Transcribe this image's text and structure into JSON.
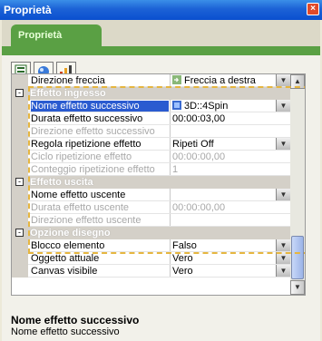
{
  "window": {
    "title": "Proprietà",
    "close_label": "×"
  },
  "tab": {
    "label": "Proprietà"
  },
  "toolbar": {
    "buttons": [
      "categorized-view-icon",
      "object-icon",
      "chart-icon"
    ]
  },
  "rows": [
    {
      "kind": "prop",
      "name": "Direzione freccia",
      "value": "Freccia a destra",
      "value_icon": "arrow-image-icon",
      "dropdown": true
    },
    {
      "kind": "cat",
      "name": "Effetto ingresso",
      "toggle": "-"
    },
    {
      "kind": "prop",
      "name": "Nome effetto successivo",
      "value": "3D::4Spin",
      "value_icon": "effect-icon",
      "dropdown": true,
      "selected": true
    },
    {
      "kind": "prop",
      "name": "Durata effetto successivo",
      "value": "00:00:03,00"
    },
    {
      "kind": "prop",
      "name": "Direzione effetto successivo",
      "value": "",
      "disabled": true
    },
    {
      "kind": "prop",
      "name": "Regola ripetizione effetto",
      "value": "Ripeti Off",
      "dropdown": true
    },
    {
      "kind": "prop",
      "name": "Ciclo ripetizione effetto",
      "value": "00:00:00,00",
      "disabled": true
    },
    {
      "kind": "prop",
      "name": "Conteggio ripetizione effetto",
      "value": "1",
      "disabled": true
    },
    {
      "kind": "cat",
      "name": "Effetto uscita",
      "toggle": "-"
    },
    {
      "kind": "prop",
      "name": "Nome effetto uscente",
      "value": "",
      "dropdown": true
    },
    {
      "kind": "prop",
      "name": "Durata effetto uscente",
      "value": "00:00:00,00",
      "disabled": true
    },
    {
      "kind": "prop",
      "name": "Direzione effetto uscente",
      "value": "",
      "disabled": true
    },
    {
      "kind": "cat",
      "name": "Opzione disegno",
      "toggle": "-"
    },
    {
      "kind": "prop",
      "name": "Blocco elemento",
      "value": "Falso",
      "dropdown": true
    },
    {
      "kind": "prop",
      "name": "Oggetto attuale",
      "value": "Vero",
      "dropdown": true
    },
    {
      "kind": "prop",
      "name": "Canvas visibile",
      "value": "Vero",
      "dropdown": true
    }
  ],
  "description": {
    "title": "Nome effetto successivo",
    "text": "Nome effetto successivo"
  },
  "colors": {
    "title_bar": "#1c62d6",
    "tab": "#5aa044",
    "selection": "#2a5bd0",
    "highlight_dash": "#e6b640"
  }
}
